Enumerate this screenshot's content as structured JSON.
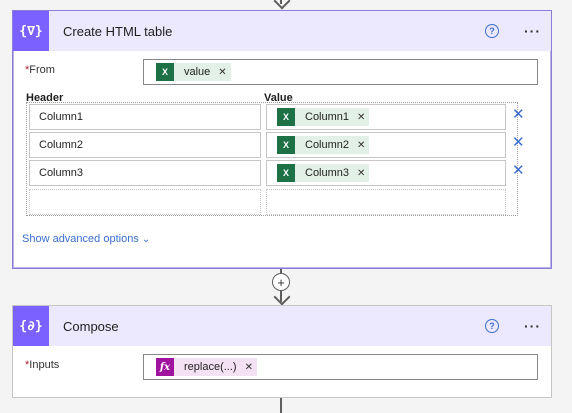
{
  "card1": {
    "title": "Create HTML table",
    "help_icon": "question-circle-icon",
    "more_icon": "ellipsis-icon",
    "from_label": "From",
    "from_token": {
      "label": "value",
      "icon": "excel-icon"
    },
    "header_col": "Header",
    "value_col": "Value",
    "rows": [
      {
        "header": "Column1",
        "value": "Column1"
      },
      {
        "header": "Column2",
        "value": "Column2"
      },
      {
        "header": "Column3",
        "value": "Column3"
      }
    ],
    "show_advanced": "Show advanced options"
  },
  "add_step_icon": "plus-icon",
  "card2": {
    "title": "Compose",
    "inputs_label": "Inputs",
    "inputs_token": {
      "label": "replace(...)",
      "icon": "fx-icon"
    }
  },
  "colors": {
    "accent": "#7b61ff",
    "header_bg": "#ece8fd",
    "link": "#3b6fcf",
    "excel": "#1e7145",
    "expression": "#a0139e"
  }
}
